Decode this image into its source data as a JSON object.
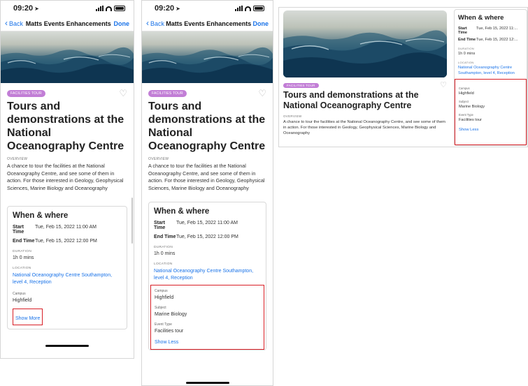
{
  "status": {
    "time": "09:20"
  },
  "nav": {
    "back": "Back",
    "title": "Matts Events Enhancements",
    "done": "Done"
  },
  "event": {
    "tag": "FACILITIES TOUR",
    "title": "Tours and demonstrations at the National Oceanography Centre",
    "overview_label": "OVERVIEW",
    "description": "A chance to tour the facilities at the National Oceanography Centre, and see some of them in action. For those interested in Geology, Geophysical Sciences, Marine Biology and Oceanography"
  },
  "when_where": {
    "heading": "When & where",
    "start_label": "Start Time",
    "start_value": "Tue, Feb 15, 2022 11:00 AM",
    "end_label": "End Time",
    "end_value": "Tue, Feb 15, 2022 12:00 PM",
    "web_start_value": "Tue, Feb 15, 2022 11:...",
    "web_end_value": "Tue, Feb 15, 2022 12:...",
    "duration_label": "DURATION",
    "duration_value": "1h 0 mins",
    "location_label": "LOCATION",
    "location_value": "National Oceanography Centre Southampton, level 4, Reception",
    "campus_label": "Campus",
    "campus_value": "Highfield",
    "subject_label": "Subject",
    "subject_value": "Marine Biology",
    "event_type_label": "Event Type",
    "event_type_value": "Facilities tour",
    "show_more": "Show More",
    "show_less": "Show Less"
  },
  "colors": {
    "link": "#1a73e8",
    "highlight": "#d81f26",
    "tag": "#c27ed6"
  },
  "icons": {
    "back": "chevron-left-icon",
    "favorite": "heart-outline-icon",
    "location_arrow": "location-arrow-icon"
  }
}
